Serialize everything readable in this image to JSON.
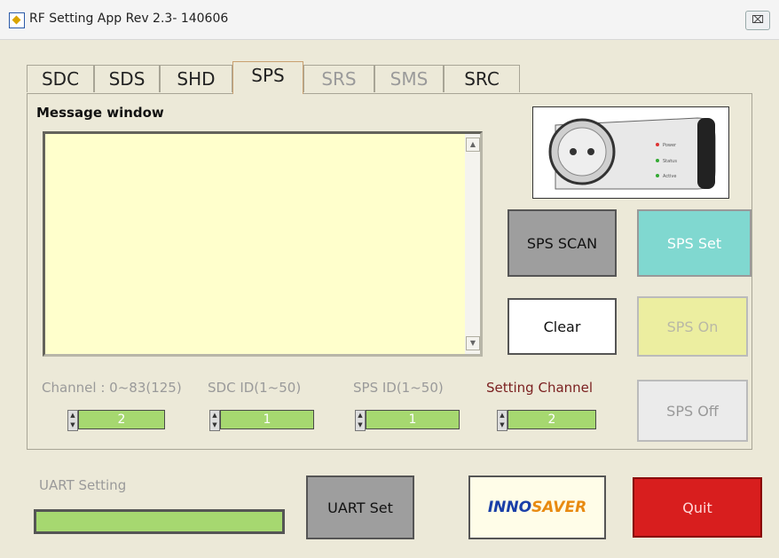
{
  "window": {
    "title": "RF Setting App Rev 2.3- 140606",
    "close_glyph": "⌧"
  },
  "tabs": [
    {
      "label": "SDC",
      "state": "normal"
    },
    {
      "label": "SDS",
      "state": "normal"
    },
    {
      "label": "SHD",
      "state": "normal"
    },
    {
      "label": "SPS",
      "state": "active"
    },
    {
      "label": "SRS",
      "state": "disabled"
    },
    {
      "label": "SMS",
      "state": "disabled"
    },
    {
      "label": "SRC",
      "state": "normal"
    }
  ],
  "message_window": {
    "label": "Message window",
    "content": ""
  },
  "product_image": {
    "leds": [
      "Power",
      "Status",
      "Active"
    ]
  },
  "buttons": {
    "sps_scan": "SPS SCAN",
    "sps_set": "SPS Set",
    "clear": "Clear",
    "sps_on": "SPS On",
    "sps_off": "SPS Off",
    "uart_set": "UART Set",
    "quit": "Quit"
  },
  "logo": {
    "part1": "INNO",
    "part2": "SAVER"
  },
  "fields": {
    "channel": {
      "label": "Channel : 0~83(125)",
      "value": "2"
    },
    "sdc_id": {
      "label": "SDC ID(1~50)",
      "value": "1"
    },
    "sps_id": {
      "label": "SPS ID(1~50)",
      "value": "1"
    },
    "setting_channel": {
      "label": "Setting Channel",
      "value": "2"
    }
  },
  "uart": {
    "label": "UART Setting",
    "value": ""
  },
  "colors": {
    "field_green": "#a6d870",
    "message_bg": "#ffffcc",
    "quit_red": "#d81e1e",
    "set_teal": "#80d8d0"
  }
}
